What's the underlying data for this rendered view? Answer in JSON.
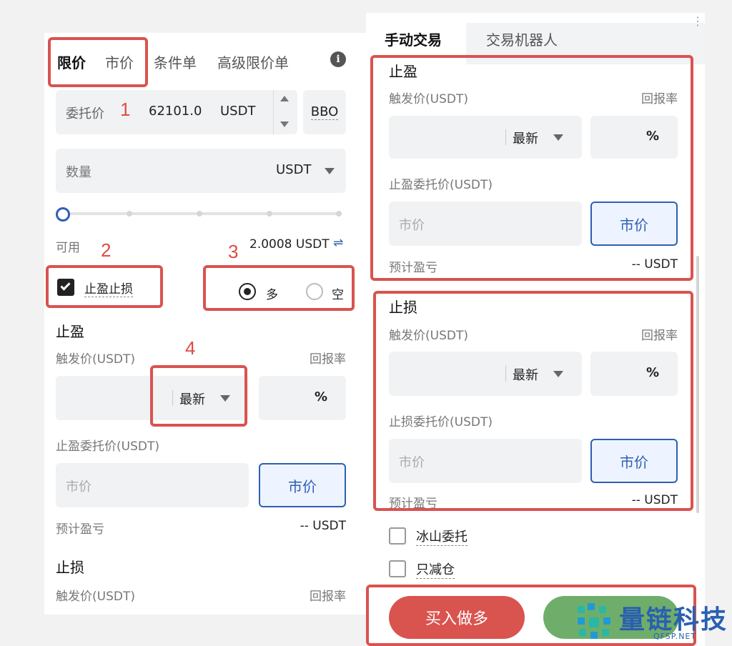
{
  "left": {
    "tabs": [
      "限价",
      "市价",
      "条件单",
      "高级限价单"
    ],
    "info_icon": "info-icon",
    "price_field": {
      "label": "委托价",
      "value": "62101.0",
      "unit": "USDT",
      "bbo": "BBO"
    },
    "quantity_field": {
      "placeholder": "数量",
      "unit": "USDT"
    },
    "available": {
      "label": "可用",
      "value": "2.0008 USDT"
    },
    "tpsl_checkbox": {
      "label": "止盈止损",
      "checked": true
    },
    "direction": {
      "long": "多",
      "short": "空",
      "selected": "多"
    },
    "take_profit": {
      "title": "止盈",
      "trigger_label": "触发价(USDT)",
      "ratio_label": "回报率",
      "price_type": "最新",
      "percent": "%",
      "order_label": "止盈委托价(USDT)",
      "order_placeholder": "市价",
      "market_button": "市价",
      "pnl_label": "预计盈亏",
      "pnl_value": "-- USDT"
    },
    "stop_loss": {
      "title": "止损",
      "trigger_label": "触发价(USDT)",
      "ratio_label": "回报率"
    }
  },
  "right": {
    "tabs": [
      "手动交易",
      "交易机器人"
    ],
    "take_profit": {
      "title": "止盈",
      "trigger_label": "触发价(USDT)",
      "ratio_label": "回报率",
      "price_type": "最新",
      "percent": "%",
      "order_label": "止盈委托价(USDT)",
      "order_placeholder": "市价",
      "market_button": "市价",
      "pnl_label": "预计盈亏",
      "pnl_value": "-- USDT"
    },
    "stop_loss": {
      "title": "止损",
      "trigger_label": "触发价(USDT)",
      "ratio_label": "回报率",
      "price_type": "最新",
      "percent": "%",
      "order_label": "止损委托价(USDT)",
      "order_placeholder": "市价",
      "market_button": "市价",
      "pnl_label": "预计盈亏",
      "pnl_value": "-- USDT"
    },
    "options": [
      "冰山委托",
      "只减仓"
    ],
    "buy_button": "买入做多"
  },
  "annotations": [
    "1",
    "2",
    "3",
    "4"
  ],
  "watermark": {
    "text": "量链科技",
    "sub": "QFSP.NET"
  },
  "colors": {
    "annotation_red": "#d9534f",
    "buy_red": "#d9534f",
    "sell_green": "#6fae6a",
    "market_blue": "#2f5fb3"
  }
}
